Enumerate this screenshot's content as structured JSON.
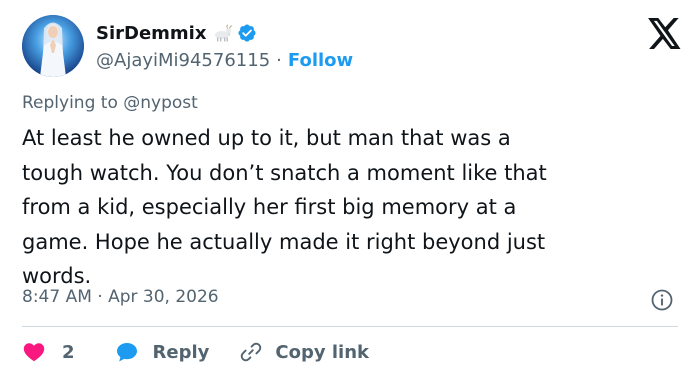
{
  "user": {
    "display_name": "SirDemmix",
    "handle": "@AjayiMi94576115",
    "separator": "·",
    "follow_label": "Follow"
  },
  "icons": {
    "avatar": "praying-figure-avatar",
    "badge_emoji": "goat-icon",
    "verified": "verified-badge-icon",
    "brand": "x-logo-icon",
    "info": "info-icon",
    "like": "heart-icon",
    "reply": "chat-bubble-icon",
    "copy": "link-icon"
  },
  "colors": {
    "accent": "#1d9bf0",
    "like": "#f91880",
    "muted": "#536471",
    "text": "#0f1419"
  },
  "tweet": {
    "replying_to": "Replying to @nypost",
    "text": "At least he owned up to it, but man that was a\ntough watch. You don’t snatch a moment like that\nfrom a kid, especially her first big memory at a\ngame. Hope he actually made it right beyond just\nwords.",
    "timestamp": "8:47 AM · Apr 30, 2026"
  },
  "actions": {
    "like_count": "2",
    "reply_label": "Reply",
    "copy_label": "Copy link"
  }
}
